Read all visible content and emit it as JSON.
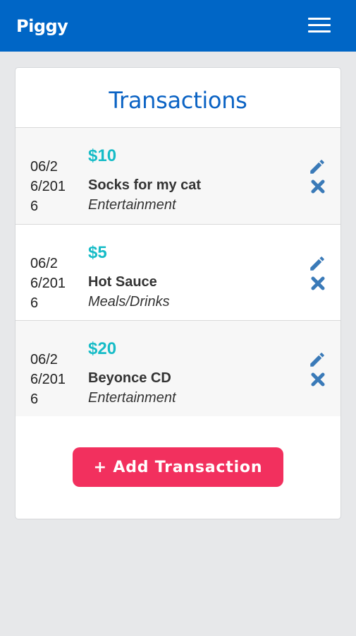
{
  "app": {
    "brand": "Piggy",
    "accent": "#0066c6"
  },
  "panel": {
    "title": "Transactions"
  },
  "transactions": [
    {
      "date": "06/26/2016",
      "amount": "$10",
      "name": "Socks for my cat",
      "category": "Entertainment"
    },
    {
      "date": "06/26/2016",
      "amount": "$5",
      "name": "Hot Sauce",
      "category": "Meals/Drinks"
    },
    {
      "date": "06/26/2016",
      "amount": "$20",
      "name": "Beyonce CD",
      "category": "Entertainment"
    }
  ],
  "actions": {
    "add_label": "+ Add Transaction"
  },
  "icons": {
    "menu": "hamburger-menu-icon",
    "edit": "pencil-icon",
    "delete": "close-icon"
  },
  "colors": {
    "amount": "#17bcc7",
    "title": "#0b63c4",
    "add_button": "#f2305e",
    "icon": "#3a7ab8"
  }
}
